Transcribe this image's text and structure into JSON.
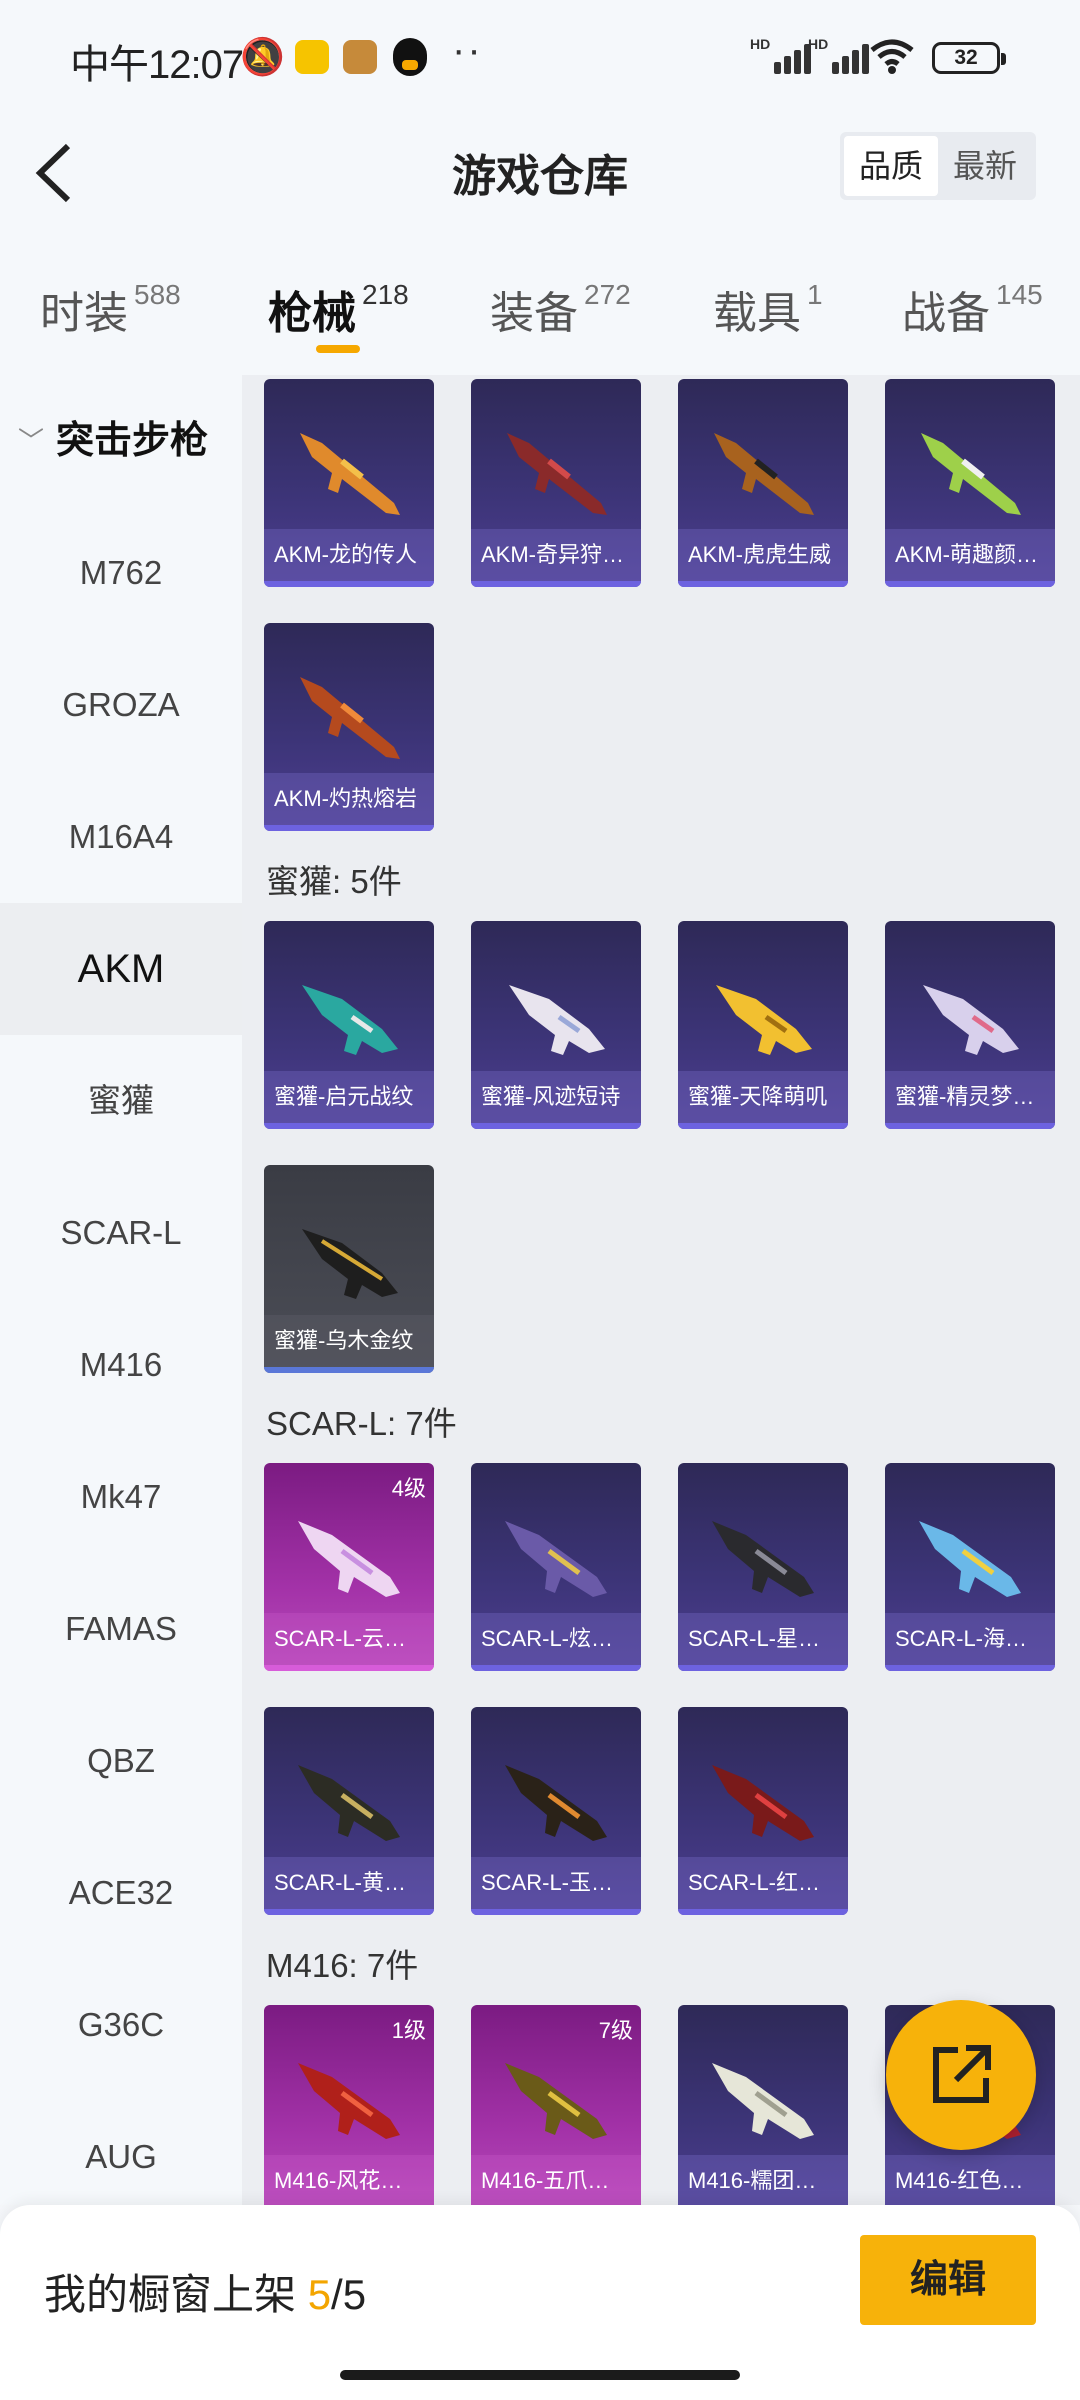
{
  "status_bar": {
    "time": "中午12:07",
    "battery": "32",
    "hd1": "HD",
    "hd2": "HD"
  },
  "header": {
    "title": "游戏仓库",
    "sort_options": [
      "品质",
      "最新"
    ],
    "sort_active": "品质"
  },
  "tabs": [
    {
      "label": "时装",
      "count": "588"
    },
    {
      "label": "枪械",
      "count": "218"
    },
    {
      "label": "装备",
      "count": "272"
    },
    {
      "label": "载具",
      "count": "1"
    },
    {
      "label": "战备",
      "count": "145"
    }
  ],
  "active_tab": "枪械",
  "sidebar": {
    "group": "突击步枪",
    "items": [
      "M762",
      "GROZA",
      "M16A4",
      "AKM",
      "蜜獾",
      "SCAR-L",
      "M416",
      "Mk47",
      "FAMAS",
      "QBZ",
      "ACE32",
      "G36C",
      "AUG"
    ],
    "active": "AKM"
  },
  "sections": [
    {
      "label": "",
      "items": [
        {
          "name": "AKM-龙的传人",
          "level": ""
        },
        {
          "name": "AKM-奇异狩…",
          "level": ""
        },
        {
          "name": "AKM-虎虎生威",
          "level": ""
        },
        {
          "name": "AKM-萌趣颜…",
          "level": ""
        },
        {
          "name": "AKM-灼热熔岩",
          "level": ""
        }
      ]
    },
    {
      "label": "蜜獾: 5件",
      "items": [
        {
          "name": "蜜獾-启元战纹",
          "level": ""
        },
        {
          "name": "蜜獾-风迹短诗",
          "level": ""
        },
        {
          "name": "蜜獾-天降萌叽",
          "level": ""
        },
        {
          "name": "蜜獾-精灵梦…",
          "level": ""
        },
        {
          "name": "蜜獾-乌木金纹",
          "level": ""
        }
      ]
    },
    {
      "label": "SCAR-L: 7件",
      "items": [
        {
          "name": "SCAR-L-云…",
          "level": "4级"
        },
        {
          "name": "SCAR-L-炫…",
          "level": ""
        },
        {
          "name": "SCAR-L-星…",
          "level": ""
        },
        {
          "name": "SCAR-L-海…",
          "level": ""
        },
        {
          "name": "SCAR-L-黄…",
          "level": ""
        },
        {
          "name": "SCAR-L-玉…",
          "level": ""
        },
        {
          "name": "SCAR-L-红…",
          "level": ""
        }
      ]
    },
    {
      "label": "M416: 7件",
      "items": [
        {
          "name": "M416-风花…",
          "level": "1级"
        },
        {
          "name": "M416-五爪…",
          "level": "7级"
        },
        {
          "name": "M416-糯团…",
          "level": ""
        },
        {
          "name": "M416-红色…",
          "level": ""
        }
      ]
    }
  ],
  "bottom_bar": {
    "shelf_label": "我的橱窗上架",
    "shelf_used": "5",
    "shelf_sep": "/",
    "shelf_total": "5",
    "edit_label": "编辑"
  },
  "colors": {
    "accent": "#f7b20a",
    "card_purple": "#3c3477",
    "card_gold_tier": "#a332a8"
  },
  "icons": [
    "back-arrow-icon",
    "share-export-icon",
    "chevron-down-icon",
    "wifi-icon",
    "muted-bell-icon"
  ]
}
